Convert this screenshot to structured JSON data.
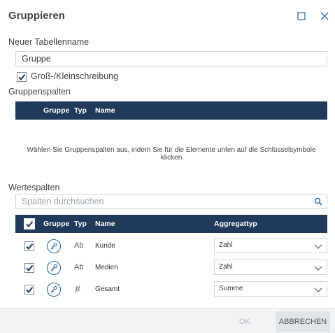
{
  "dialog": {
    "title": "Gruppieren",
    "maximize_icon": "maximize-icon",
    "close_icon": "close-icon"
  },
  "table_name": {
    "label": "Neuer Tabellenname",
    "value": "Gruppe"
  },
  "case_sensitive": {
    "label": "Groß-/Kleinschreibung",
    "checked": true
  },
  "group_columns": {
    "label": "Gruppenspalten",
    "headers": [
      "Gruppe",
      "Typ",
      "Name"
    ],
    "empty_message": "Wählen Sie Gruppenspalten aus, indem Sie für die Elemente unten auf die Schlüsselsymbole klicken"
  },
  "value_columns": {
    "label": "Wertespalten",
    "search_placeholder": "Spalten durchsuchen",
    "headers": [
      "Gruppe",
      "Typ",
      "Name",
      "Aggregattyp"
    ],
    "rows": [
      {
        "checked": true,
        "typ": "Ab",
        "name": "Kunde",
        "aggregate": "Zahl"
      },
      {
        "checked": true,
        "typ": "Ab",
        "name": "Medien",
        "aggregate": "Zahl"
      },
      {
        "checked": true,
        "typ": "#",
        "name": "Gesamt",
        "aggregate": "Summe"
      }
    ]
  },
  "buttons": {
    "ok": "OK",
    "cancel": "ABBRECHEN"
  },
  "colors": {
    "header_bg": "#1f3a5a",
    "accent": "#2e6b9c"
  }
}
